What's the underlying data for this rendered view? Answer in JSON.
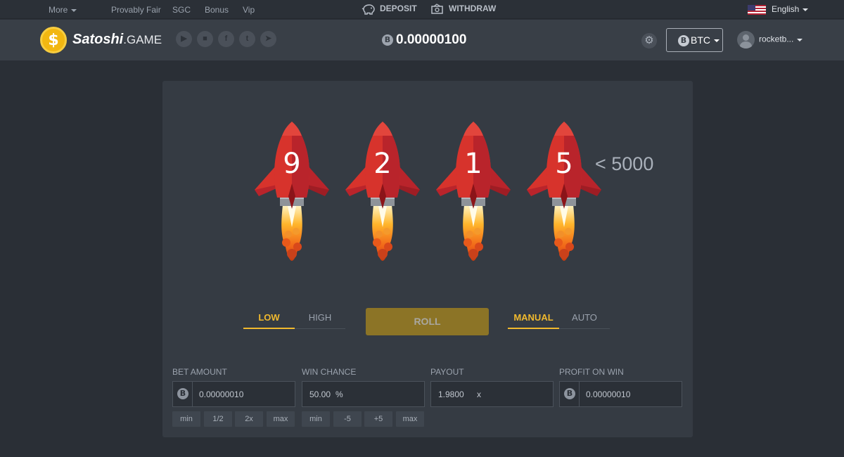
{
  "topbar": {
    "more": "More",
    "nav": [
      "Provably Fair",
      "SGC",
      "Bonus",
      "Vip"
    ],
    "deposit": "DEPOSIT",
    "withdraw": "WITHDRAW",
    "language": "English"
  },
  "header": {
    "brand": "Satoshi",
    "brand_tld": ".GAME",
    "socials": [
      "youtube-icon",
      "chat-icon",
      "facebook-icon",
      "twitter-icon",
      "telegram-icon"
    ],
    "balance": "0.00000100",
    "currency": "BTC",
    "username": "rocketb..."
  },
  "game": {
    "digits": [
      "9",
      "2",
      "1",
      "5"
    ],
    "target": "< 5000",
    "direction": {
      "low": "LOW",
      "high": "HIGH",
      "selected": "LOW"
    },
    "roll": "ROLL",
    "mode": {
      "manual": "MANUAL",
      "auto": "AUTO",
      "selected": "MANUAL"
    }
  },
  "form": {
    "bet": {
      "label": "BET AMOUNT",
      "value": "0.00000010",
      "buttons": [
        "min",
        "1/2",
        "2x",
        "max"
      ]
    },
    "chance": {
      "label": "WIN CHANCE",
      "value": "50.00",
      "unit": "%",
      "buttons": [
        "min",
        "-5",
        "+5",
        "max"
      ]
    },
    "payout": {
      "label": "PAYOUT",
      "value": "1.9800",
      "unit": "x"
    },
    "profit": {
      "label": "PROFIT ON WIN",
      "value": "0.00000010"
    }
  },
  "colors": {
    "accent": "#f0b92e",
    "roll_button": "#8c7426",
    "rocket_body": "#d7332c",
    "background": "#2a2f36",
    "panel": "#353b43"
  }
}
